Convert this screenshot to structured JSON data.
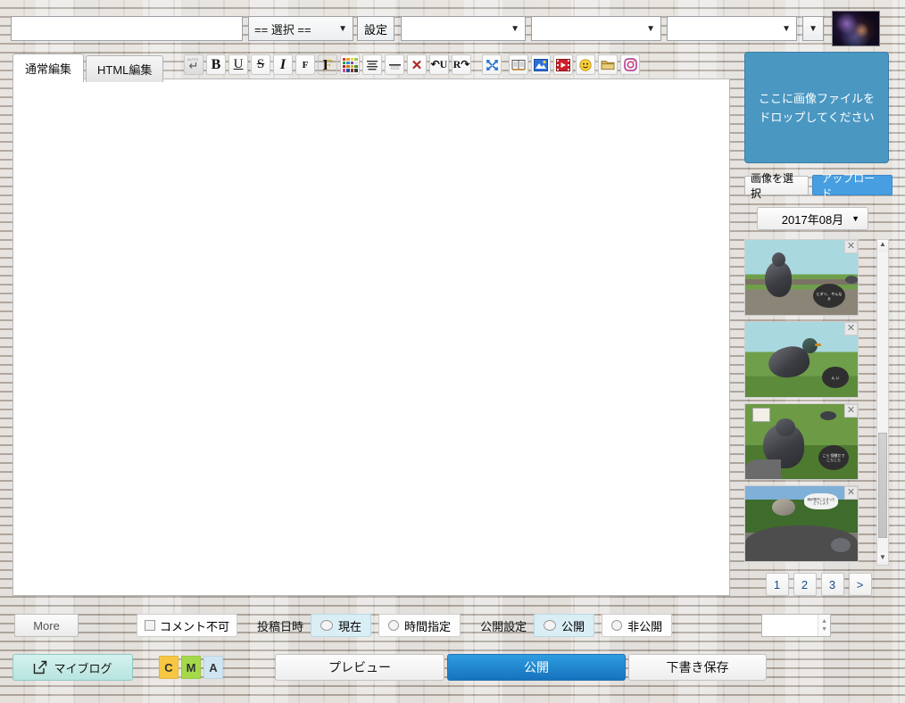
{
  "topbar": {
    "title_value": "",
    "title_placeholder": "",
    "category_label": "== 選択 ==",
    "setting_label": "設定",
    "select_a": "",
    "select_b": "",
    "select_c": "",
    "caret": "▼",
    "thumbnail_name": "header-image-thumbnail"
  },
  "tabs": [
    {
      "label": "通常編集",
      "active": true
    },
    {
      "label": "HTML編集",
      "active": false
    }
  ],
  "toolbar": {
    "buttons": [
      {
        "name": "auto-return-button",
        "label": "↵",
        "mini": "AUTO"
      },
      {
        "name": "bold-button",
        "label": "B"
      },
      {
        "name": "underline-button",
        "label": "U"
      },
      {
        "name": "strikethrough-button",
        "label": "S"
      },
      {
        "name": "italic-button",
        "label": "I"
      },
      {
        "name": "font-size-small-button",
        "label": "F"
      },
      {
        "name": "font-size-large-button",
        "label": "F"
      },
      {
        "name": "text-color-palette-button",
        "label": ""
      },
      {
        "name": "align-button",
        "label": ""
      },
      {
        "name": "horizontal-rule-button",
        "label": ""
      },
      {
        "name": "clear-format-button",
        "label": "✕"
      },
      {
        "name": "undo-button",
        "label": "↶U"
      },
      {
        "name": "redo-button",
        "label": "R↷"
      },
      {
        "name": "collapse-button",
        "label": ""
      },
      {
        "name": "book-insert-button",
        "label": ""
      },
      {
        "name": "image-insert-button",
        "label": ""
      },
      {
        "name": "video-insert-button",
        "label": ""
      },
      {
        "name": "emoji-insert-button",
        "label": ""
      },
      {
        "name": "folder-insert-button",
        "label": ""
      },
      {
        "name": "instagram-insert-button",
        "label": ""
      }
    ],
    "palette_colors": [
      "#e03030",
      "#f0a020",
      "#f3d433",
      "#8fce3f",
      "#2f9e3f",
      "#2f8ed0",
      "#7a49b8",
      "#e0e0e0",
      "#b02020",
      "#d07a10",
      "#c9b020",
      "#4f9020",
      "#cf4a8f",
      "#2a4fa0",
      "#7c3f20",
      "#3a3a3a"
    ]
  },
  "editor": {
    "content": ""
  },
  "image_panel": {
    "dropzone_line1": "ここに画像ファイルを",
    "dropzone_line2": "ドロップしてください",
    "select_image_label": "画像を選択",
    "upload_label": "アップロード",
    "month_value": "2017年08月",
    "caret": "▼",
    "delete_icon": "✕",
    "thumbnails": [
      {
        "name": "pigeon-on-wall",
        "bubble": "ヒダリ、\nやんなぁ"
      },
      {
        "name": "pigeon-walking-grass",
        "bubble": "ん\nい"
      },
      {
        "name": "pigeon-closeup-sign",
        "bubble": "こら\n怪獣だで\nこらこら"
      },
      {
        "name": "pigeon-on-hat",
        "bubble": "鳩が帽子に止まった\nどうしよう"
      }
    ],
    "pagination": [
      "1",
      "2",
      "3",
      ">"
    ]
  },
  "options": {
    "more_label": "More",
    "comment_disabled_label": "コメント不可",
    "comment_disabled_checked": false,
    "post_datetime_label": "投稿日時",
    "datetime_options": [
      {
        "label": "現在",
        "selected": true
      },
      {
        "label": "時間指定",
        "selected": false
      }
    ],
    "visibility_label": "公開設定",
    "visibility_options": [
      {
        "label": "公開",
        "selected": true
      },
      {
        "label": "非公開",
        "selected": false
      }
    ],
    "number_value": "",
    "spinner_up": "▲",
    "spinner_down": "▼"
  },
  "actions": {
    "myblog_label": "マイブログ",
    "badges": [
      "C",
      "M",
      "A"
    ],
    "preview_label": "プレビュー",
    "publish_label": "公開",
    "draft_label": "下書き保存"
  }
}
